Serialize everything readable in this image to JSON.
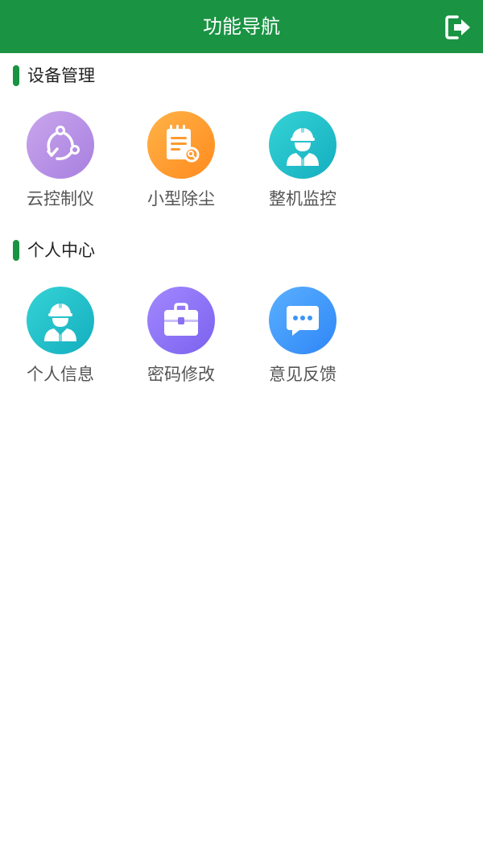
{
  "header": {
    "title": "功能导航",
    "logout_icon": "logout-icon",
    "background_color": "#1a9343"
  },
  "sections": [
    {
      "title": "设备管理",
      "items": [
        {
          "label": "云控制仪",
          "icon": "cloud-control-icon",
          "color": "#b48ce6"
        },
        {
          "label": "小型除尘",
          "icon": "dust-removal-icon",
          "color": "#ff9a2e"
        },
        {
          "label": "整机监控",
          "icon": "worker-monitor-icon",
          "color": "#1fbccb"
        }
      ]
    },
    {
      "title": "个人中心",
      "items": [
        {
          "label": "个人信息",
          "icon": "personal-info-icon",
          "color": "#1fbccb"
        },
        {
          "label": "密码修改",
          "icon": "briefcase-icon",
          "color": "#8a70f2"
        },
        {
          "label": "意见反馈",
          "icon": "chat-bubble-icon",
          "color": "#3c95f8"
        }
      ]
    }
  ]
}
